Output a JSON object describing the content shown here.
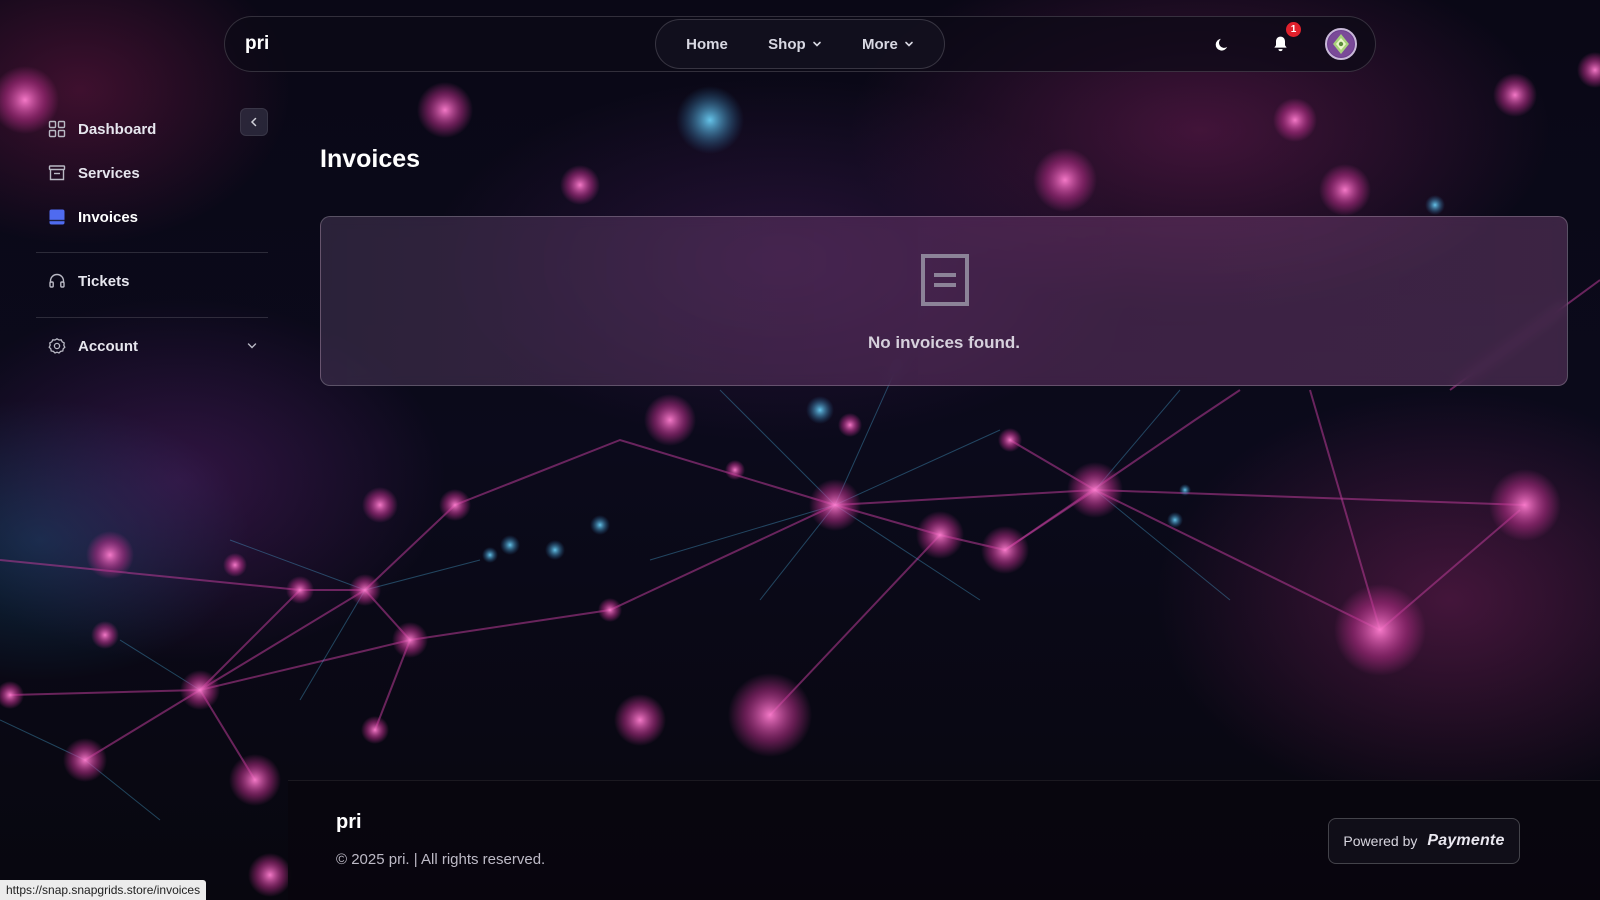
{
  "brand": "pri",
  "nav": {
    "home": "Home",
    "shop": "Shop",
    "more": "More",
    "notifications_count": "1",
    "icons": [
      "moon-icon",
      "bell-icon",
      "avatar"
    ]
  },
  "sidebar": {
    "items": [
      {
        "label": "Dashboard",
        "icon": "grid-icon"
      },
      {
        "label": "Services",
        "icon": "server-icon"
      },
      {
        "label": "Invoices",
        "icon": "invoice-icon",
        "active": true
      },
      {
        "label": "Tickets",
        "icon": "headset-icon"
      },
      {
        "label": "Account",
        "icon": "gear-icon"
      }
    ]
  },
  "main": {
    "title": "Invoices",
    "empty_message": "No invoices found."
  },
  "footer": {
    "brand": "pri",
    "copyright": "© 2025 pri. | All rights reserved.",
    "powered_by": "Powered by",
    "powered_logo": "Paymente"
  },
  "status_url": "https://snap.snapgrids.store/invoices",
  "colors": {
    "accent": "#4f6bf0",
    "badge": "#e0202c",
    "background": "#07060f"
  }
}
